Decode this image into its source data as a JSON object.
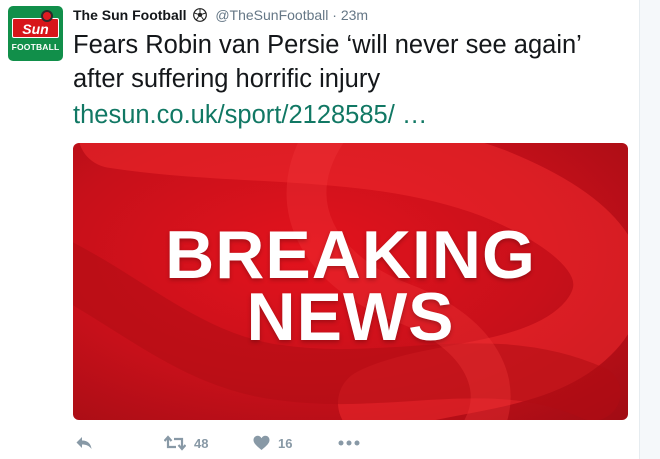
{
  "tweet": {
    "author_name": "The Sun Football",
    "handle": "@TheSunFootball",
    "separator": "·",
    "time": "23m",
    "avatar_logo_text": "Sun",
    "avatar_sub_text": "FOOTBALL",
    "text": "Fears Robin van Persie ‘will never see again’ after suffering horrific injury",
    "link": "thesun.co.uk/sport/2128585/  …"
  },
  "media": {
    "line1": "BREAKING",
    "line2": "NEWS"
  },
  "actions": {
    "retweet_count": "48",
    "like_count": "16"
  },
  "colors": {
    "link": "#117864",
    "media_red": "#d7141d",
    "muted": "#8899a6"
  },
  "icons": [
    "soccer-ball-icon",
    "reply-icon",
    "retweet-icon",
    "heart-icon",
    "more-icon"
  ]
}
